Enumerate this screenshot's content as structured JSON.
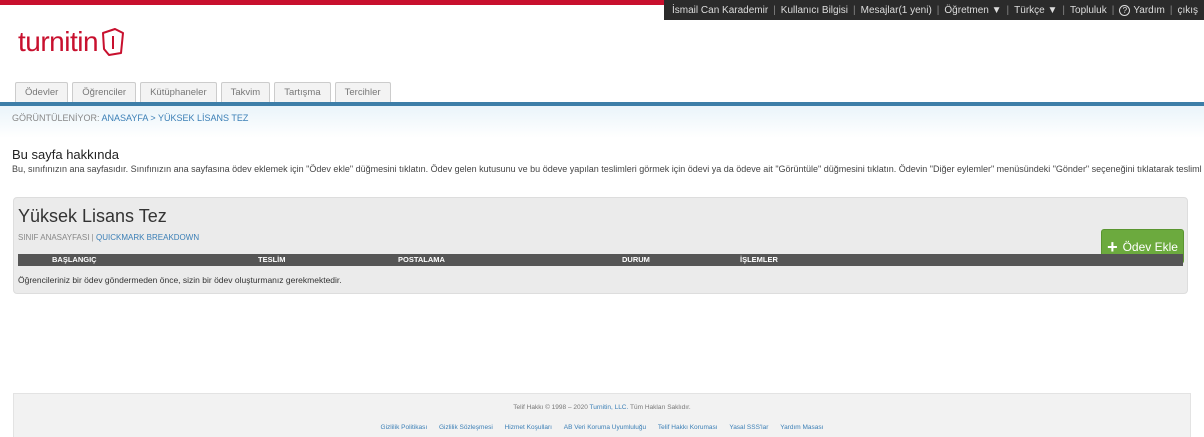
{
  "topbar": {
    "items": [
      "İsmail Can Karademir",
      "Kullanıcı Bilgisi",
      "Mesajlar(1 yeni)",
      "Öğretmen ▼",
      "Türkçe ▼",
      "Topluluk",
      "Yardım",
      "çıkış"
    ],
    "help_symbol": "?"
  },
  "logo": {
    "text": "turnitin",
    "icon": "turnitin-document-icon",
    "color": "#c8102e"
  },
  "tabs": [
    "Ödevler",
    "Öğrenciler",
    "Kütüphaneler",
    "Takvim",
    "Tartışma",
    "Tercihler"
  ],
  "breadcrumb": {
    "prefix": "GÖRÜNTÜLENİYOR:",
    "path": "ANASAYFA > YÜKSEK LİSANS TEZ"
  },
  "about": {
    "title": "Bu sayfa hakkında",
    "text": "Bu, sınıfınızın ana sayfasıdır. Sınıfınızın ana sayfasına ödev eklemek için \"Ödev ekle\" düğmesini tıklatın. Ödev gelen kutusunu ve bu ödeve yapılan teslimleri görmek için ödevi ya da ödeve ait \"Görüntüle\" düğmesini tıklatın. Ödevin \"Diğer eylemler\" menüsündeki \"Gönder\" seçeneğini tıklatarak teslimlerinizi gönderebilirsiniz."
  },
  "class": {
    "title": "Yüksek Lisans Tez",
    "homepage_link": "SINIF ANASAYFASI",
    "separator": "|",
    "quickmark_link": "QUICKMARK BREAKDOWN",
    "add_button": "Ödev Ekle"
  },
  "table": {
    "headers": [
      "BAŞLANGIÇ",
      "TESLİM",
      "POSTALAMA",
      "DURUM",
      "İŞLEMLER"
    ],
    "empty_message": "Öğrencileriniz bir ödev göndermeden önce, sizin bir ödev oluşturmanız gerekmektedir."
  },
  "footer": {
    "copyright_prefix": "Telif Hakkı © 1998 – 2020",
    "copyright_brand": "Turnitin, LLC.",
    "copyright_suffix": "Tüm Hakları Saklıdır.",
    "links": [
      "Gizlilik Politikası",
      "Gizlilik Sözleşmesi",
      "Hizmet Koşulları",
      "AB Veri Koruma Uyumluluğu",
      "Telif Hakkı Koruması",
      "Yasal SSS'lar",
      "Yardım Masası"
    ]
  },
  "colors": {
    "accent_red": "#c8102e",
    "tab_bar": "#3d7ea8",
    "add_button_green": "#6caa3e",
    "link_blue": "#3b7fb6"
  }
}
